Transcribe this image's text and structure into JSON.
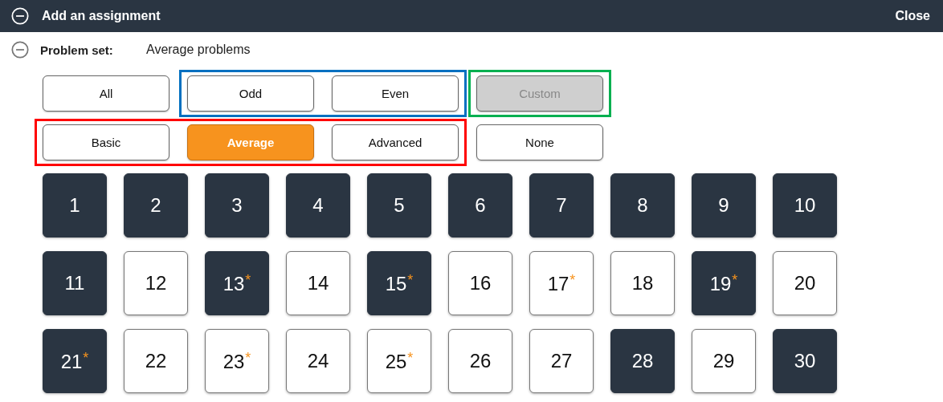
{
  "header": {
    "title": "Add an assignment",
    "close": "Close"
  },
  "problem_set": {
    "label": "Problem set:",
    "value": "Average problems"
  },
  "filter_rows": [
    [
      {
        "buttons": [
          {
            "label": "All",
            "selected": false,
            "disabled": false
          }
        ]
      },
      {
        "color": "#0070c0",
        "buttons": [
          {
            "label": "Odd",
            "selected": false,
            "disabled": false
          },
          {
            "label": "Even",
            "selected": false,
            "disabled": false
          }
        ]
      },
      {
        "color": "#00b050",
        "buttons": [
          {
            "label": "Custom",
            "selected": false,
            "disabled": true
          }
        ]
      }
    ],
    [
      {
        "color": "#ff0000",
        "buttons": [
          {
            "label": "Basic",
            "selected": false,
            "disabled": false
          },
          {
            "label": "Average",
            "selected": true,
            "disabled": false
          },
          {
            "label": "Advanced",
            "selected": false,
            "disabled": false
          }
        ]
      },
      {
        "buttons": [
          {
            "label": "None",
            "selected": false,
            "disabled": false
          }
        ]
      }
    ]
  ],
  "problems": [
    {
      "label": "1",
      "selected": true
    },
    {
      "label": "2",
      "selected": true
    },
    {
      "label": "3",
      "selected": true
    },
    {
      "label": "4",
      "selected": true
    },
    {
      "label": "5",
      "selected": true
    },
    {
      "label": "6",
      "selected": true
    },
    {
      "label": "7",
      "selected": true
    },
    {
      "label": "8",
      "selected": true
    },
    {
      "label": "9",
      "selected": true
    },
    {
      "label": "10",
      "selected": true
    },
    {
      "label": "11",
      "selected": true
    },
    {
      "label": "12",
      "selected": false
    },
    {
      "label": "13",
      "selected": true,
      "note": "*"
    },
    {
      "label": "14",
      "selected": false
    },
    {
      "label": "15",
      "selected": true,
      "note": "*"
    },
    {
      "label": "16",
      "selected": false
    },
    {
      "label": "17",
      "selected": false,
      "note": "*"
    },
    {
      "label": "18",
      "selected": false
    },
    {
      "label": "19",
      "selected": true,
      "note": "*"
    },
    {
      "label": "20",
      "selected": false
    },
    {
      "label": "21",
      "selected": true,
      "note": "*"
    },
    {
      "label": "22",
      "selected": false
    },
    {
      "label": "23",
      "selected": false,
      "note": "*"
    },
    {
      "label": "24",
      "selected": false
    },
    {
      "label": "25",
      "selected": false,
      "note": "*"
    },
    {
      "label": "26",
      "selected": false
    },
    {
      "label": "27",
      "selected": false
    },
    {
      "label": "28",
      "selected": true
    },
    {
      "label": "29",
      "selected": false
    },
    {
      "label": "30",
      "selected": true
    }
  ]
}
